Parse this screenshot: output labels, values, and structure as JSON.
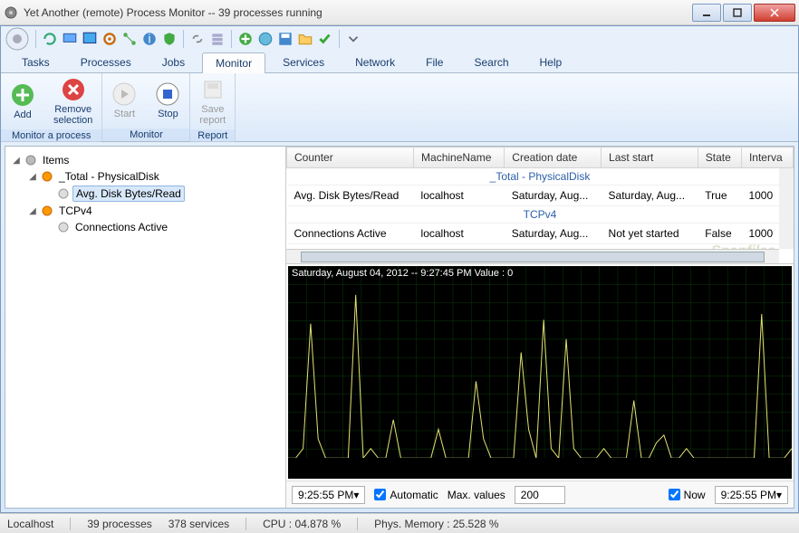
{
  "window": {
    "title": "Yet Another (remote) Process Monitor -- 39 processes running"
  },
  "menus": {
    "tasks": "Tasks",
    "processes": "Processes",
    "jobs": "Jobs",
    "monitor": "Monitor",
    "services": "Services",
    "network": "Network",
    "file": "File",
    "search": "Search",
    "help": "Help"
  },
  "ribbon": {
    "add": "Add",
    "remove": "Remove\nselection",
    "start": "Start",
    "stop": "Stop",
    "save": "Save\nreport",
    "group_monitor_process": "Monitor a process",
    "group_monitor": "Monitor",
    "group_report": "Report"
  },
  "tree": {
    "root": "Items",
    "node1": "_Total - PhysicalDisk",
    "node1a": "Avg. Disk Bytes/Read",
    "node2": "TCPv4",
    "node2a": "Connections Active"
  },
  "table": {
    "headers": {
      "counter": "Counter",
      "machine": "MachineName",
      "creation": "Creation date",
      "laststart": "Last start",
      "state": "State",
      "interval": "Interva"
    },
    "group1": "_Total - PhysicalDisk",
    "row1": {
      "counter": "Avg. Disk Bytes/Read",
      "machine": "localhost",
      "creation": "Saturday, Aug...",
      "laststart": "Saturday, Aug...",
      "state": "True",
      "interval": "1000"
    },
    "group2": "TCPv4",
    "row2": {
      "counter": "Connections Active",
      "machine": "localhost",
      "creation": "Saturday, Aug...",
      "laststart": "Not yet started",
      "state": "False",
      "interval": "1000"
    }
  },
  "chart_data": {
    "type": "line",
    "title": "Saturday, August 04, 2012 -- 9:27:45 PM  Value : 0",
    "xlabel": "",
    "ylabel": "",
    "x_range": [
      "9:25:55 PM",
      "9:25:55 PM"
    ],
    "series": [
      {
        "name": "Avg. Disk Bytes/Read",
        "color": "#e0e070",
        "values": [
          0,
          0,
          5,
          70,
          10,
          0,
          0,
          0,
          0,
          85,
          0,
          5,
          0,
          0,
          20,
          0,
          0,
          0,
          0,
          0,
          15,
          0,
          0,
          0,
          0,
          40,
          10,
          0,
          0,
          0,
          0,
          55,
          15,
          0,
          72,
          5,
          0,
          62,
          5,
          0,
          0,
          0,
          5,
          0,
          0,
          0,
          30,
          0,
          0,
          8,
          12,
          0,
          0,
          5,
          0,
          0,
          0,
          0,
          0,
          0,
          0,
          0,
          0,
          75,
          0,
          0,
          0,
          5
        ]
      }
    ],
    "ylim": [
      0,
      100
    ]
  },
  "graph_footer": {
    "time_left": "9:25:55 PM",
    "automatic": "Automatic",
    "maxvalues": "Max. values",
    "maxvalues_value": "200",
    "now": "Now",
    "time_right": "9:25:55 PM"
  },
  "status": {
    "host": "Localhost",
    "procs": "39 processes",
    "svcs": "378 services",
    "cpu": "CPU : 04.878 %",
    "mem": "Phys. Memory : 25.528 %"
  },
  "watermark": "Snapfiles"
}
